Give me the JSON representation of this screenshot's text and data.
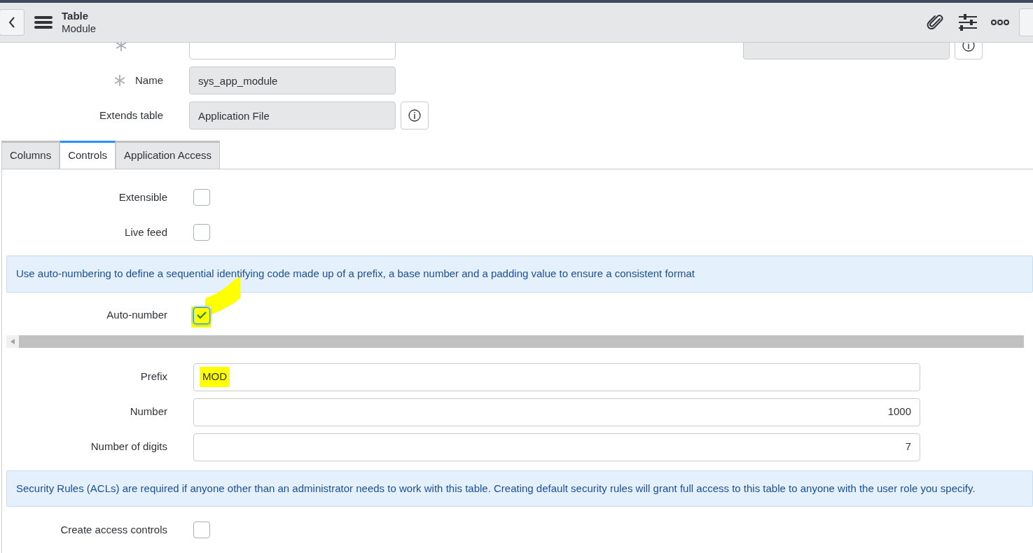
{
  "header": {
    "title": "Table",
    "subtitle": "Module"
  },
  "top_fields": [
    {
      "required": true,
      "readonly": false,
      "info": false
    },
    {
      "label": "Name",
      "value": "sys_app_module",
      "required": true,
      "readonly": true,
      "info": false
    },
    {
      "label": "Extends table",
      "value": "Application File",
      "required": false,
      "readonly": true,
      "info": true
    }
  ],
  "application_field": {
    "readonly": true,
    "info": true
  },
  "tabs": [
    {
      "label": "Columns",
      "selected": false
    },
    {
      "label": "Controls",
      "selected": true
    },
    {
      "label": "Application Access",
      "selected": false
    }
  ],
  "controls": [
    {
      "kind": "checkbox",
      "label": "Extensible",
      "checked": false,
      "highlighted": false
    },
    {
      "kind": "checkbox",
      "label": "Live feed",
      "checked": false,
      "highlighted": false
    },
    {
      "kind": "info",
      "text": "Use auto-numbering to define a sequential identifying code made up of a prefix, a base number and a padding value to ensure a consistent format"
    },
    {
      "kind": "checkbox",
      "label": "Auto-number",
      "checked": true,
      "highlighted": true
    },
    {
      "kind": "scrollbar"
    },
    {
      "kind": "text",
      "label": "Prefix",
      "value": "MOD",
      "highlighted": true
    },
    {
      "kind": "number",
      "label": "Number",
      "value": "1000",
      "highlighted": false
    },
    {
      "kind": "number",
      "label": "Number of digits",
      "value": "7",
      "highlighted": false
    },
    {
      "kind": "info",
      "text": "Security Rules (ACLs) are required if anyone other than an administrator needs to work with this table. Creating default security rules will grant full access to this table to anyone with the user role you specify."
    },
    {
      "kind": "checkbox",
      "label": "Create access controls",
      "checked": false,
      "highlighted": false
    }
  ]
}
